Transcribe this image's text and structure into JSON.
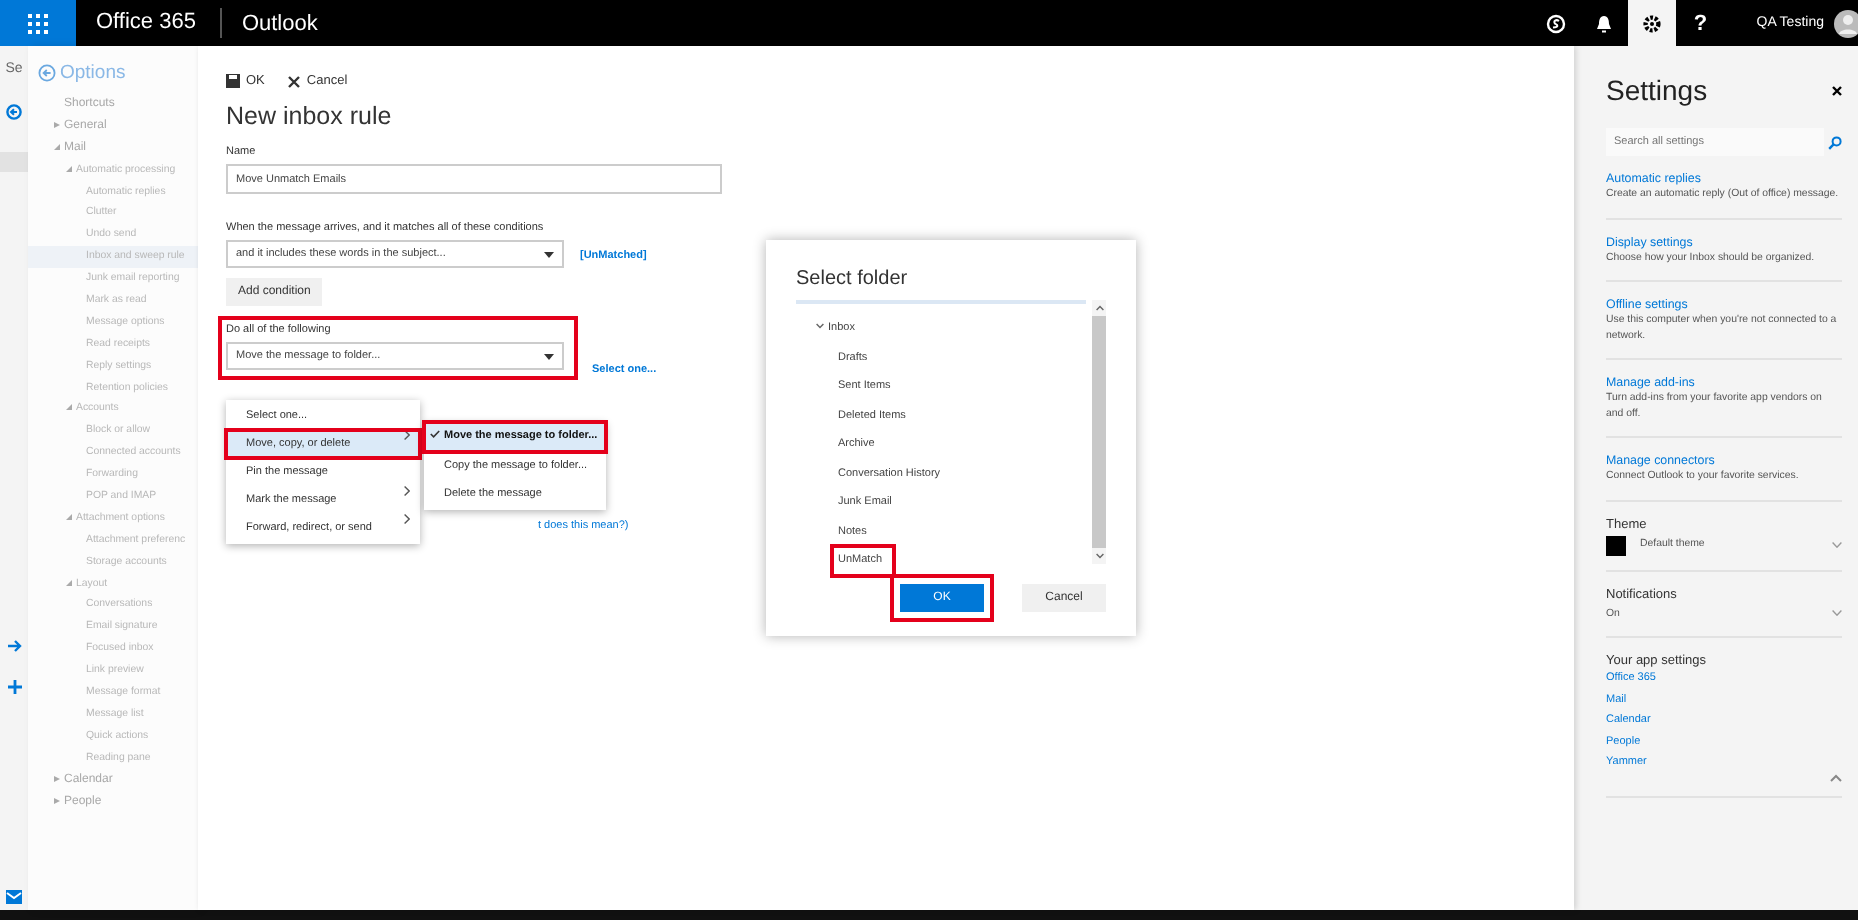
{
  "top_bar": {
    "suite": "Office 365",
    "app": "Outlook",
    "user": "QA Testing",
    "help_label": "?",
    "settings_selected": true
  },
  "left_strip": {
    "text": "Se"
  },
  "options_nav": {
    "title": "Options",
    "items": [
      {
        "label": "Shortcuts",
        "selected": false
      },
      {
        "label": "General",
        "selected": false,
        "expanded": false
      },
      {
        "label": "Mail",
        "selected": false,
        "expanded": true,
        "children": [
          {
            "label": "Automatic processing",
            "selected": false,
            "expanded": true,
            "children": [
              {
                "label": "Automatic replies",
                "selected": false
              },
              {
                "label": "Clutter",
                "selected": false
              },
              {
                "label": "Undo send",
                "selected": false
              },
              {
                "label": "Inbox and sweep rule",
                "selected": true
              },
              {
                "label": "Junk email reporting",
                "selected": false
              },
              {
                "label": "Mark as read",
                "selected": false
              },
              {
                "label": "Message options",
                "selected": false
              },
              {
                "label": "Read receipts",
                "selected": false
              },
              {
                "label": "Reply settings",
                "selected": false
              },
              {
                "label": "Retention policies",
                "selected": false
              }
            ]
          },
          {
            "label": "Accounts",
            "selected": false,
            "expanded": true,
            "children": [
              {
                "label": "Block or allow",
                "selected": false
              },
              {
                "label": "Connected accounts",
                "selected": false
              },
              {
                "label": "Forwarding",
                "selected": false
              },
              {
                "label": "POP and IMAP",
                "selected": false
              }
            ]
          },
          {
            "label": "Attachment options",
            "selected": false,
            "expanded": true,
            "children": [
              {
                "label": "Attachment preferenc",
                "selected": false
              },
              {
                "label": "Storage accounts",
                "selected": false
              }
            ]
          },
          {
            "label": "Layout",
            "selected": false,
            "expanded": true,
            "children": [
              {
                "label": "Conversations",
                "selected": false
              },
              {
                "label": "Email signature",
                "selected": false
              },
              {
                "label": "Focused inbox",
                "selected": false
              },
              {
                "label": "Link preview",
                "selected": false
              },
              {
                "label": "Message format",
                "selected": false
              },
              {
                "label": "Message list",
                "selected": false
              },
              {
                "label": "Quick actions",
                "selected": false
              },
              {
                "label": "Reading pane",
                "selected": false
              }
            ]
          }
        ]
      },
      {
        "label": "Calendar",
        "selected": false,
        "expanded": false
      },
      {
        "label": "People",
        "selected": false,
        "expanded": false
      }
    ]
  },
  "rule_form": {
    "toolbar": [
      {
        "label": "OK",
        "kind": "save"
      },
      {
        "label": "Cancel",
        "kind": "cancel"
      }
    ],
    "title": "New inbox rule",
    "name_label": "Name",
    "name_value": "Move Unmatch Emails",
    "conditions_label": "When the message arrives, and it matches all of these conditions",
    "condition_value": "and it includes these words in the subject...",
    "condition_link": "[UnMatched]",
    "add_condition": "Add condition",
    "actions": {
      "label": "Do all of the following",
      "value": "Move the message to folder...",
      "annotated": true
    },
    "action_link": "Select one...",
    "help_link": "t does this mean?)",
    "menu": [
      {
        "label": "Select one...",
        "has_submenu": false,
        "selected": false,
        "annotated": false
      },
      {
        "label": "Move, copy, or delete",
        "has_submenu": true,
        "selected": true,
        "annotated": true
      },
      {
        "label": "Pin the message",
        "has_submenu": false,
        "selected": false,
        "annotated": false
      },
      {
        "label": "Mark the message",
        "has_submenu": true,
        "selected": false,
        "annotated": false
      },
      {
        "label": "Forward, redirect, or send",
        "has_submenu": true,
        "selected": false,
        "annotated": false
      }
    ],
    "submenu": [
      {
        "label": "Move the message to folder...",
        "checked": true,
        "annotated": true
      },
      {
        "label": "Copy the message to folder...",
        "checked": false,
        "annotated": false
      },
      {
        "label": "Delete the message",
        "checked": false,
        "annotated": false
      }
    ]
  },
  "dialog": {
    "title": "Select folder",
    "folders": [
      {
        "label": "Inbox",
        "expanded": true,
        "annotated": false,
        "children": [
          {
            "label": "Drafts",
            "annotated": false
          },
          {
            "label": "Sent Items",
            "annotated": false
          },
          {
            "label": "Deleted Items",
            "annotated": false
          },
          {
            "label": "Archive",
            "annotated": false
          },
          {
            "label": "Conversation History",
            "annotated": false
          },
          {
            "label": "Junk Email",
            "annotated": false
          },
          {
            "label": "Notes",
            "annotated": false
          },
          {
            "label": "UnMatch",
            "annotated": true
          }
        ]
      }
    ],
    "buttons": [
      {
        "label": "OK",
        "kind": "primary",
        "annotated": true
      },
      {
        "label": "Cancel",
        "kind": "secondary",
        "annotated": false
      }
    ]
  },
  "settings": {
    "title": "Settings",
    "search_placeholder": "Search all settings",
    "links": [
      {
        "title": "Automatic replies",
        "description": "Create an automatic reply (Out of office) message."
      },
      {
        "title": "Display settings",
        "description": "Choose how your Inbox should be organized."
      },
      {
        "title": "Offline settings",
        "description": "Use this computer when you're not connected to a network."
      },
      {
        "title": "Manage add-ins",
        "description": "Turn add-ins from your favorite app vendors on and off."
      },
      {
        "title": "Manage connectors",
        "description": "Connect Outlook to your favorite services."
      }
    ],
    "theme": {
      "label": "Theme",
      "value": "Default theme",
      "color": "#000000"
    },
    "notifications": {
      "label": "Notifications",
      "value": "On"
    },
    "app_settings": {
      "label": "Your app settings",
      "links": [
        "Office 365",
        "Mail",
        "Calendar",
        "People",
        "Yammer"
      ]
    }
  }
}
